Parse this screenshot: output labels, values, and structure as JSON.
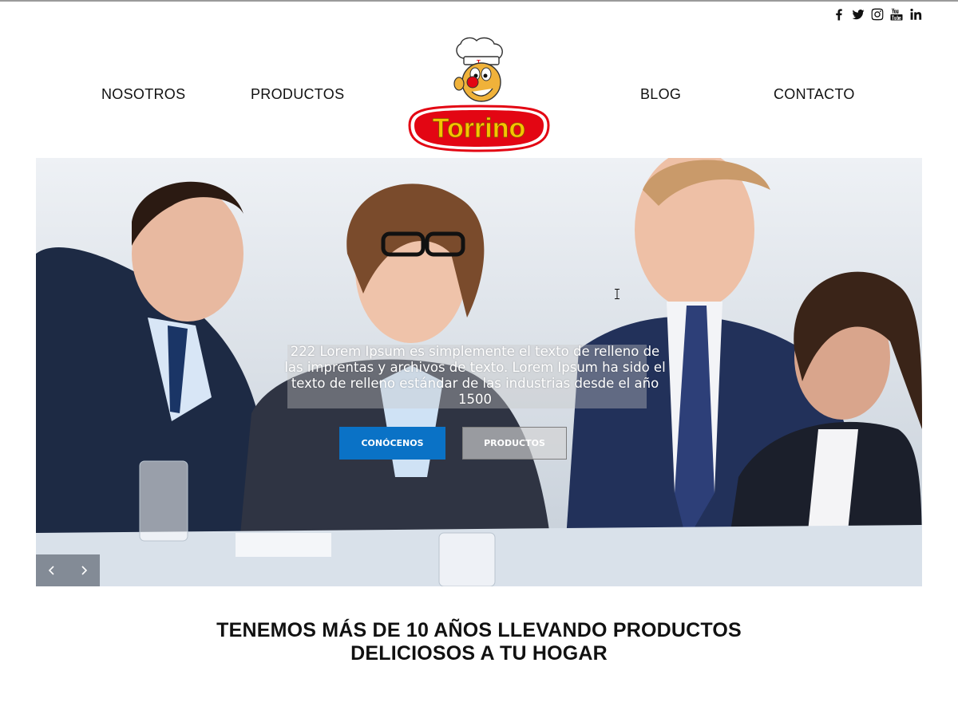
{
  "social": {
    "icons": [
      "facebook-icon",
      "twitter-icon",
      "instagram-icon",
      "youtube-icon",
      "linkedin-icon"
    ]
  },
  "nav": {
    "items": [
      {
        "label": "NOSOTROS"
      },
      {
        "label": "PRODUCTOS"
      },
      {
        "label": "BLOG"
      },
      {
        "label": "CONTACTO"
      }
    ]
  },
  "logo": {
    "text": "Torrino"
  },
  "hero": {
    "caption": "222 Lorem Ipsum es simplemente el texto de relleno de las imprentas y archivos de texto. Lorem Ipsum ha sido el texto de relleno estándar de las industrias desde el año 1500",
    "primary_button": "CONÓCENOS",
    "secondary_button": "PRODUCTOS"
  },
  "headline": {
    "line1": "TENEMOS MÁS DE 10 AÑOS LLEVANDO PRODUCTOS",
    "line2": "DELICIOSOS A TU HOGAR"
  },
  "colors": {
    "primary_button": "#0a72c6",
    "logo_red": "#e30613",
    "text": "#111111"
  }
}
